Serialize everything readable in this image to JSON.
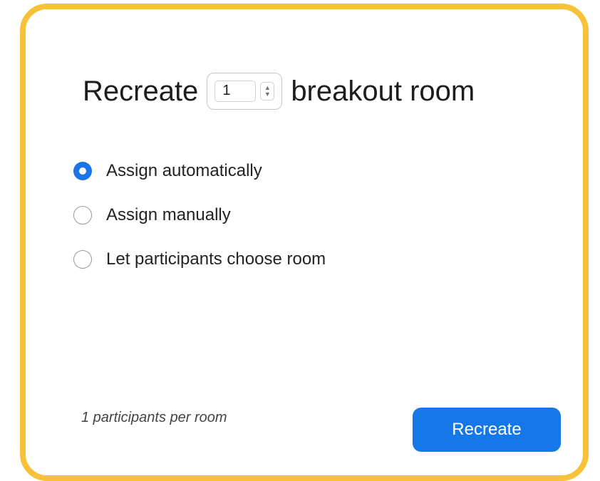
{
  "header": {
    "prefix": "Recreate",
    "suffix": "breakout room",
    "room_count": "1",
    "stepper_icon": "up-down-chevron-icon"
  },
  "options": [
    {
      "label": "Assign automatically",
      "checked": true
    },
    {
      "label": "Assign manually",
      "checked": false
    },
    {
      "label": "Let participants choose room",
      "checked": false
    }
  ],
  "footer": {
    "note": "1 participants per room",
    "button_label": "Recreate"
  },
  "colors": {
    "frame": "#f7c23a",
    "accent": "#1677e8"
  }
}
